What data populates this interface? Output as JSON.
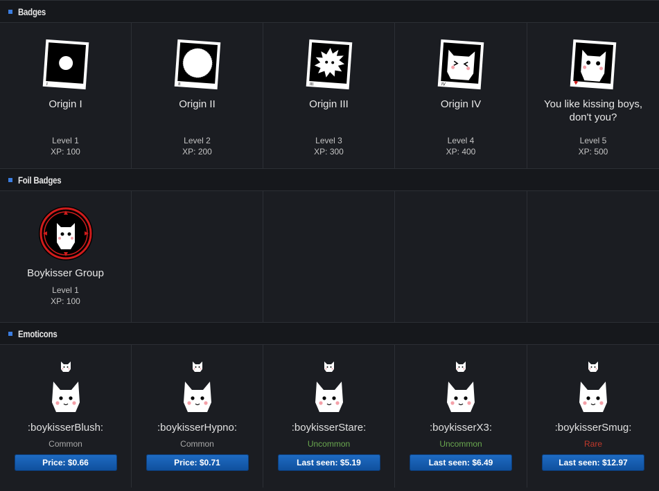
{
  "sections": {
    "badges": "Badges",
    "foil": "Foil Badges",
    "emoticons": "Emoticons"
  },
  "badges": [
    {
      "name": "Origin I",
      "level": "Level 1",
      "xp": "XP: 100",
      "icon": "origin-1-icon"
    },
    {
      "name": "Origin II",
      "level": "Level 2",
      "xp": "XP: 200",
      "icon": "origin-2-icon"
    },
    {
      "name": "Origin III",
      "level": "Level 3",
      "xp": "XP: 300",
      "icon": "origin-3-icon"
    },
    {
      "name": "Origin IV",
      "level": "Level 4",
      "xp": "XP: 400",
      "icon": "origin-4-icon"
    },
    {
      "name": "You like kissing boys, don't you?",
      "level": "Level 5",
      "xp": "XP: 500",
      "icon": "origin-5-icon"
    }
  ],
  "foil_badges": [
    {
      "name": "Boykisser Group",
      "level": "Level 1",
      "xp": "XP: 100",
      "icon": "boykisser-foil-icon"
    }
  ],
  "emoticons": [
    {
      "name": ":boykisserBlush:",
      "rarity": "Common",
      "rarity_color": "#a8a8a8",
      "price": "Price: $0.66"
    },
    {
      "name": ":boykisserHypno:",
      "rarity": "Common",
      "rarity_color": "#a8a8a8",
      "price": "Price: $0.71"
    },
    {
      "name": ":boykisserStare:",
      "rarity": "Uncommon",
      "rarity_color": "#6aa84f",
      "price": "Last seen: $5.19"
    },
    {
      "name": ":boykisserX3:",
      "rarity": "Uncommon",
      "rarity_color": "#6aa84f",
      "price": "Last seen: $6.49"
    },
    {
      "name": ":boykisserSmug:",
      "rarity": "Rare",
      "rarity_color": "#c0392b",
      "price": "Last seen: $12.97"
    }
  ],
  "colors": {
    "accent": "#3b7de0",
    "button": "#1a5fb0",
    "foil_ring": "#d01c1c"
  }
}
